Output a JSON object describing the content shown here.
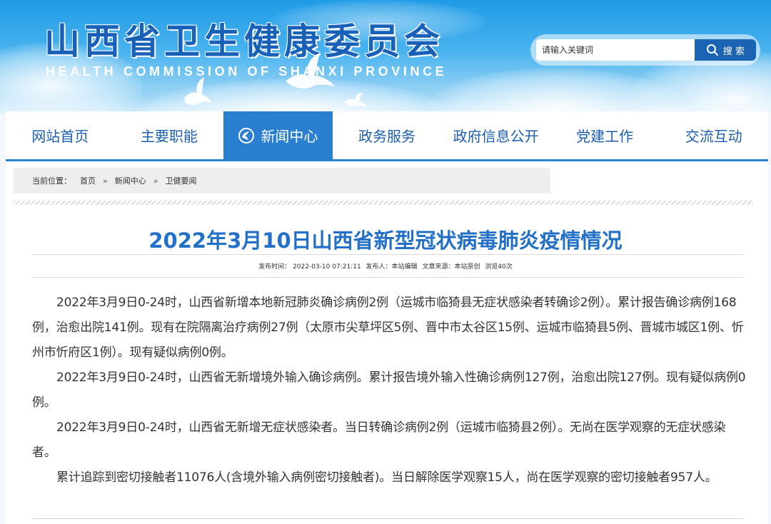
{
  "header": {
    "site_title": "山西省卫生健康委员会",
    "site_subtitle": "HEALTH COMMISSION OF SHANXI PROVINCE"
  },
  "search": {
    "placeholder": "请输入关键词",
    "button_label": "搜 索"
  },
  "nav": {
    "items": [
      {
        "label": "网站首页"
      },
      {
        "label": "主要职能"
      },
      {
        "label": "新闻中心"
      },
      {
        "label": "政务服务"
      },
      {
        "label": "政府信息公开"
      },
      {
        "label": "党建工作"
      },
      {
        "label": "交流互动"
      }
    ],
    "active_index": 2
  },
  "breadcrumb": {
    "prefix": "当前位置：",
    "items": [
      "首页",
      "新闻中心",
      "卫健要闻"
    ],
    "separator": "»"
  },
  "article": {
    "title": "2022年3月10日山西省新型冠状病毒肺炎疫情情况",
    "meta": {
      "published": "发布时间：  2022-03-10 07:21:11",
      "author": "发布人：本站编辑",
      "source": "文章来源：本站原创",
      "views": "浏览40次"
    },
    "paragraphs": [
      "2022年3月9日0-24时，山西省新增本地新冠肺炎确诊病例2例（运城市临猗县无症状感染者转确诊2例）。累计报告确诊病例168例，治愈出院141例。现有在院隔离治疗病例27例（太原市尖草坪区5例、晋中市太谷区15例、运城市临猗县5例、晋城市城区1例、忻州市忻府区1例）。现有疑似病例0例。",
      "2022年3月9日0-24时，山西省无新增境外输入确诊病例。累计报告境外输入性确诊病例127例，治愈出院127例。现有疑似病例0例。",
      "2022年3月9日0-24时，山西省无新增无症状感染者。当日转确诊病例2例（运城市临猗县2例）。无尚在医学观察的无症状感染者。",
      "累计追踪到密切接触者11076人(含境外输入病例密切接触者)。当日解除医学观察15人，尚在医学观察的密切接触者957人。"
    ]
  },
  "colors": {
    "nav_active": "#2a7fd0",
    "title_blue": "#2270c8",
    "search_button": "#1b64b4"
  }
}
